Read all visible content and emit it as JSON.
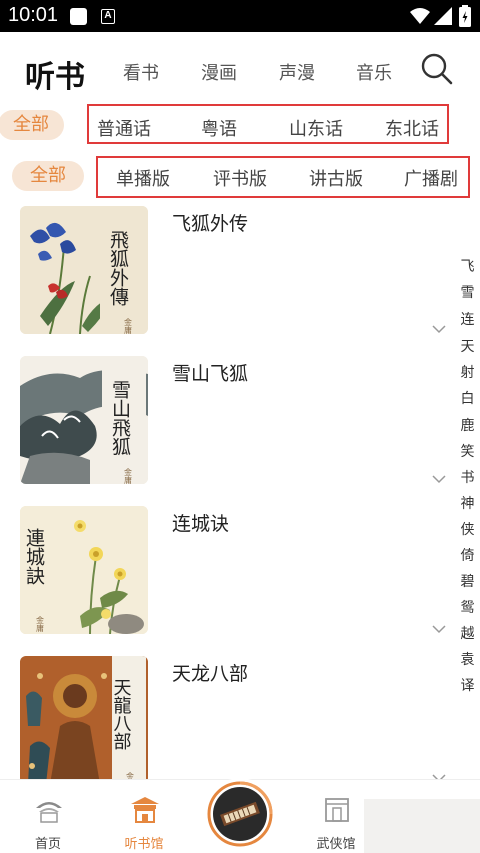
{
  "status_bar": {
    "time": "10:01",
    "a_icon_text": "A",
    "icons": [
      "notification-icon",
      "a-icon",
      "wifi-icon",
      "signal-icon",
      "battery-icon"
    ]
  },
  "top_nav": {
    "title": "听书",
    "tabs": [
      {
        "label": "看书"
      },
      {
        "label": "漫画"
      },
      {
        "label": "声漫"
      },
      {
        "label": "音乐"
      }
    ],
    "search_icon": "search-icon"
  },
  "language_filter": {
    "all_label": "全部",
    "options": [
      {
        "label": "普通话"
      },
      {
        "label": "粤语"
      },
      {
        "label": "山东话"
      },
      {
        "label": "东北话"
      }
    ]
  },
  "version_filter": {
    "all_label": "全部",
    "options": [
      {
        "label": "单播版"
      },
      {
        "label": "评书版"
      },
      {
        "label": "讲古版"
      },
      {
        "label": "广播剧"
      }
    ]
  },
  "books": [
    {
      "title": "飞狐外传",
      "cover_calligraphy": "飛狐外傳",
      "cover_author": "金庸"
    },
    {
      "title": "雪山飞狐",
      "cover_calligraphy": "雪山飛狐",
      "cover_author": "金庸"
    },
    {
      "title": "连城诀",
      "cover_calligraphy": "連城訣",
      "cover_author": "金庸"
    },
    {
      "title": "天龙八部",
      "cover_calligraphy": "天龍八部",
      "cover_author": "金庸"
    }
  ],
  "index_bar": {
    "chars": [
      "飞",
      "雪",
      "连",
      "天",
      "射",
      "白",
      "鹿",
      "笑",
      "书",
      "神",
      "侠",
      "倚",
      "碧",
      "鸳",
      "越",
      "袁",
      "译"
    ]
  },
  "bottom_nav": {
    "items": [
      {
        "label": "首页",
        "icon": "home-pavilion-icon"
      },
      {
        "label": "听书馆",
        "icon": "listening-hall-icon"
      },
      {
        "label": "武侠馆",
        "icon": "wuxia-hall-icon"
      }
    ],
    "center_icon": "play-disc-icon"
  },
  "colors": {
    "accent": "#e5873f",
    "pill_bg": "#f7e5d5",
    "highlight_box": "#e03a3a"
  }
}
